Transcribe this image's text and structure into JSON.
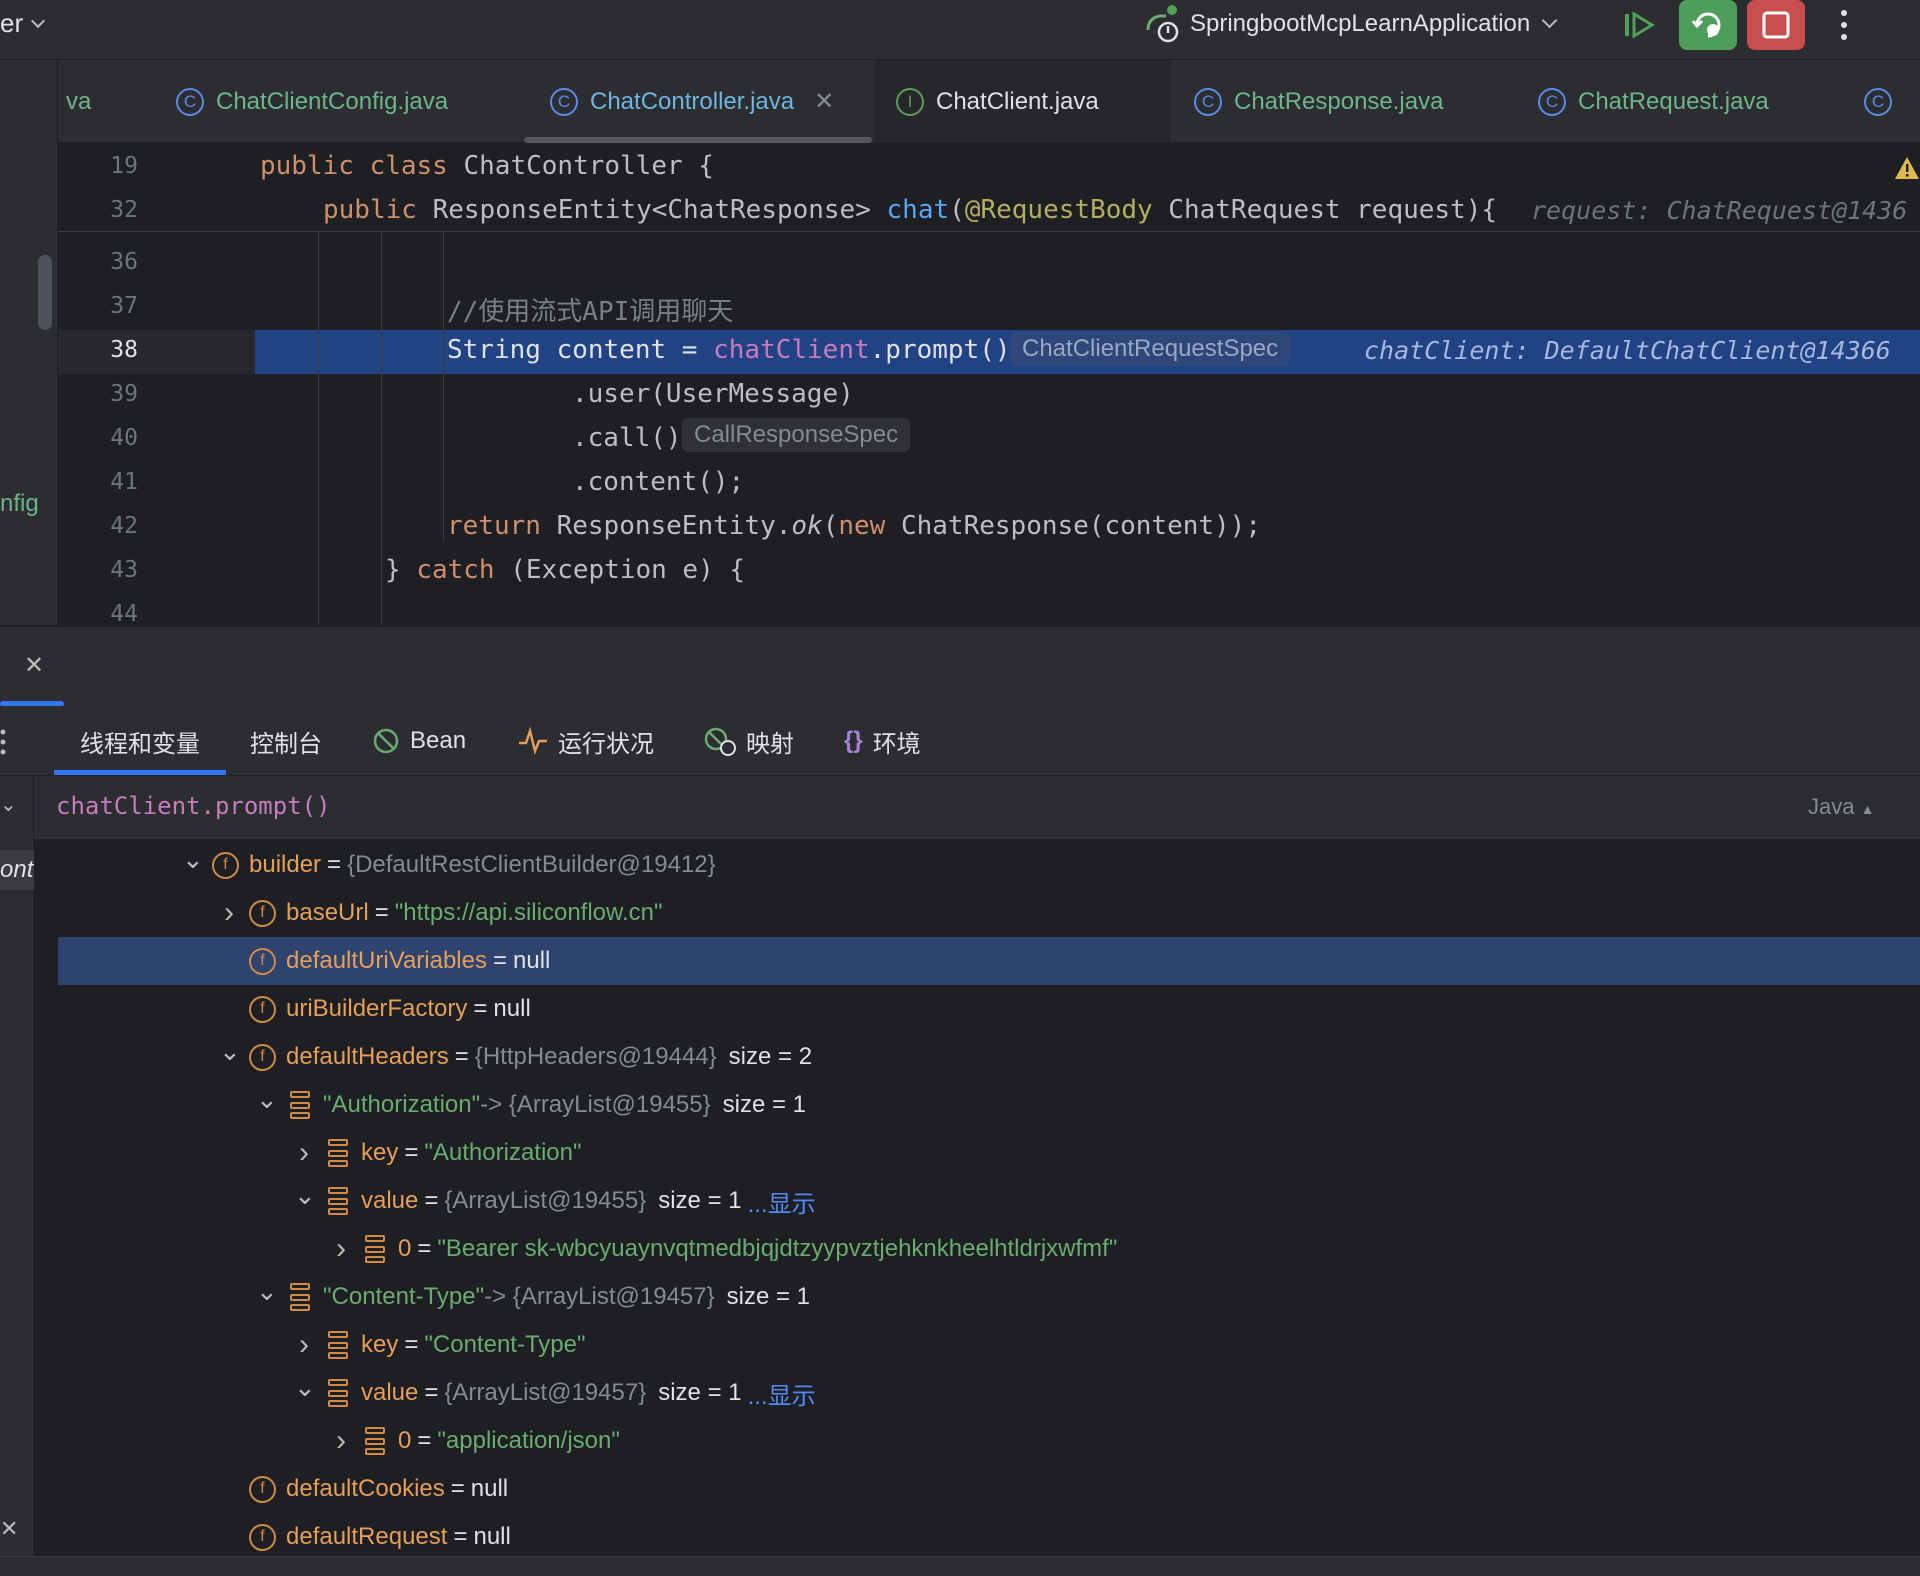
{
  "titlebar": {
    "left_text": "er",
    "run_config": "SpringbootMcpLearnApplication"
  },
  "tabs": [
    {
      "label": "va",
      "icon": "class-icon"
    },
    {
      "label": "ChatClientConfig.java",
      "icon": "class-icon"
    },
    {
      "label": "ChatController.java",
      "icon": "class-icon",
      "active": true
    },
    {
      "label": "ChatClient.java",
      "icon": "interface-icon"
    },
    {
      "label": "ChatResponse.java",
      "icon": "class-icon"
    },
    {
      "label": "ChatRequest.java",
      "icon": "class-icon"
    }
  ],
  "editor": {
    "sticky": [
      {
        "num": "19"
      },
      {
        "num": "32",
        "inline_value": "request: ChatRequest@1436"
      }
    ],
    "lines": [
      {
        "num": "36"
      },
      {
        "num": "37",
        "comment": "//使用流式API调用聊天"
      },
      {
        "num": "38",
        "hint": "ChatClientRequestSpec",
        "inline_value": "chatClient: DefaultChatClient@14366"
      },
      {
        "num": "39"
      },
      {
        "num": "40",
        "hint": "CallResponseSpec"
      },
      {
        "num": "41"
      },
      {
        "num": "42"
      },
      {
        "num": "43"
      },
      {
        "num": "44"
      }
    ],
    "left_panel_text": "nfig"
  },
  "debug": {
    "tabs": [
      "线程和变量",
      "控制台",
      "Bean",
      "运行状况",
      "映射",
      "环境"
    ],
    "eval_expression": "chatClient.prompt()",
    "language": "Java",
    "left_dock_text": "onti",
    "variables": [
      {
        "name": "builder",
        "ref": "{DefaultRestClientBuilder@19412}",
        "icon": "field-icon",
        "expanded": true
      },
      {
        "name": "baseUrl",
        "str": "\"https://api.siliconflow.cn\"",
        "icon": "field-icon",
        "expanded": false
      },
      {
        "name": "defaultUriVariables",
        "plain": "null",
        "icon": "field-icon",
        "selected": true
      },
      {
        "name": "uriBuilderFactory",
        "plain": "null",
        "icon": "field-icon"
      },
      {
        "name": "defaultHeaders",
        "ref": "{HttpHeaders@19444}",
        "size": "size = 2",
        "icon": "field-icon",
        "expanded": true
      },
      {
        "str_name": "\"Authorization\"",
        "ref": "-> {ArrayList@19455}",
        "size": "size = 1",
        "icon": "list-icon",
        "expanded": true
      },
      {
        "name": "key",
        "str": "\"Authorization\"",
        "icon": "list-icon",
        "expanded": false
      },
      {
        "name": "value",
        "ref": "{ArrayList@19455}",
        "size": "size = 1",
        "link": "...显示",
        "icon": "list-icon",
        "expanded": true
      },
      {
        "name": "0",
        "str": "\"Bearer sk-wbcyuaynvqtmedbjqjdtzyypvztjehknkheelhtldrjxwfmf\"",
        "icon": "list-icon",
        "expanded": false
      },
      {
        "str_name": "\"Content-Type\"",
        "ref": "-> {ArrayList@19457}",
        "size": "size = 1",
        "icon": "list-icon",
        "expanded": true
      },
      {
        "name": "key",
        "str": "\"Content-Type\"",
        "icon": "list-icon",
        "expanded": false
      },
      {
        "name": "value",
        "ref": "{ArrayList@19457}",
        "size": "size = 1",
        "link": "...显示",
        "icon": "list-icon",
        "expanded": true
      },
      {
        "name": "0",
        "str": "\"application/json\"",
        "icon": "list-icon",
        "expanded": false
      },
      {
        "name": "defaultCookies",
        "plain": "null",
        "icon": "field-icon"
      },
      {
        "name": "defaultRequest",
        "plain": "null",
        "icon": "field-icon"
      }
    ]
  },
  "colors": {
    "selection": "#214283",
    "accent_green": "#4ea255",
    "accent_red": "#c94f4f"
  }
}
